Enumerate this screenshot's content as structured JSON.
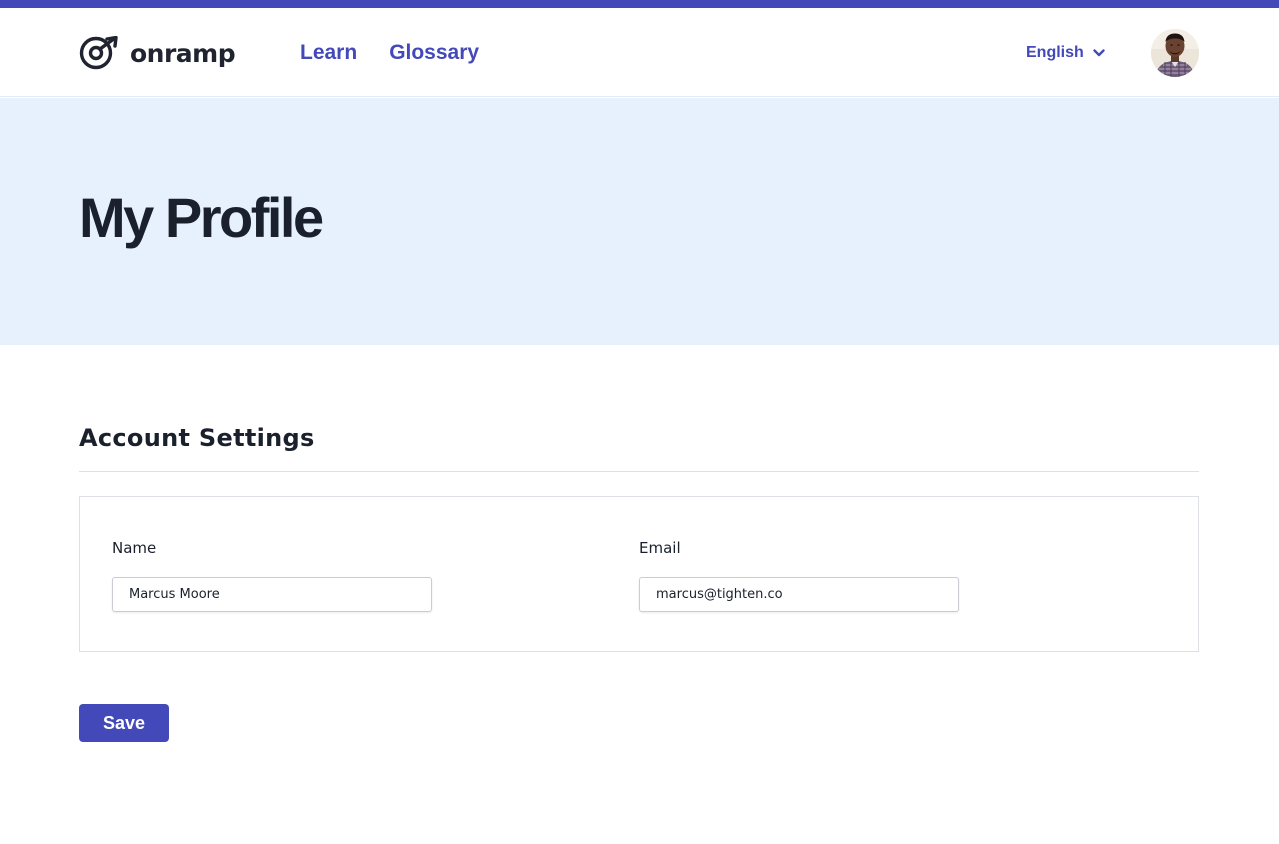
{
  "brand": {
    "name": "onramp",
    "accent_color": "#4349b8"
  },
  "nav": {
    "items": [
      {
        "label": "Learn"
      },
      {
        "label": "Glossary"
      }
    ]
  },
  "language": {
    "selected": "English",
    "icon": "chevron-down-icon"
  },
  "user": {
    "avatar_icon": "user-avatar"
  },
  "hero": {
    "title": "My Profile",
    "background": "#e7f1fd"
  },
  "account": {
    "section_title": "Account Settings",
    "fields": {
      "name": {
        "label": "Name",
        "value": "Marcus Moore"
      },
      "email": {
        "label": "Email",
        "value": "marcus@tighten.co"
      }
    },
    "save_label": "Save"
  }
}
